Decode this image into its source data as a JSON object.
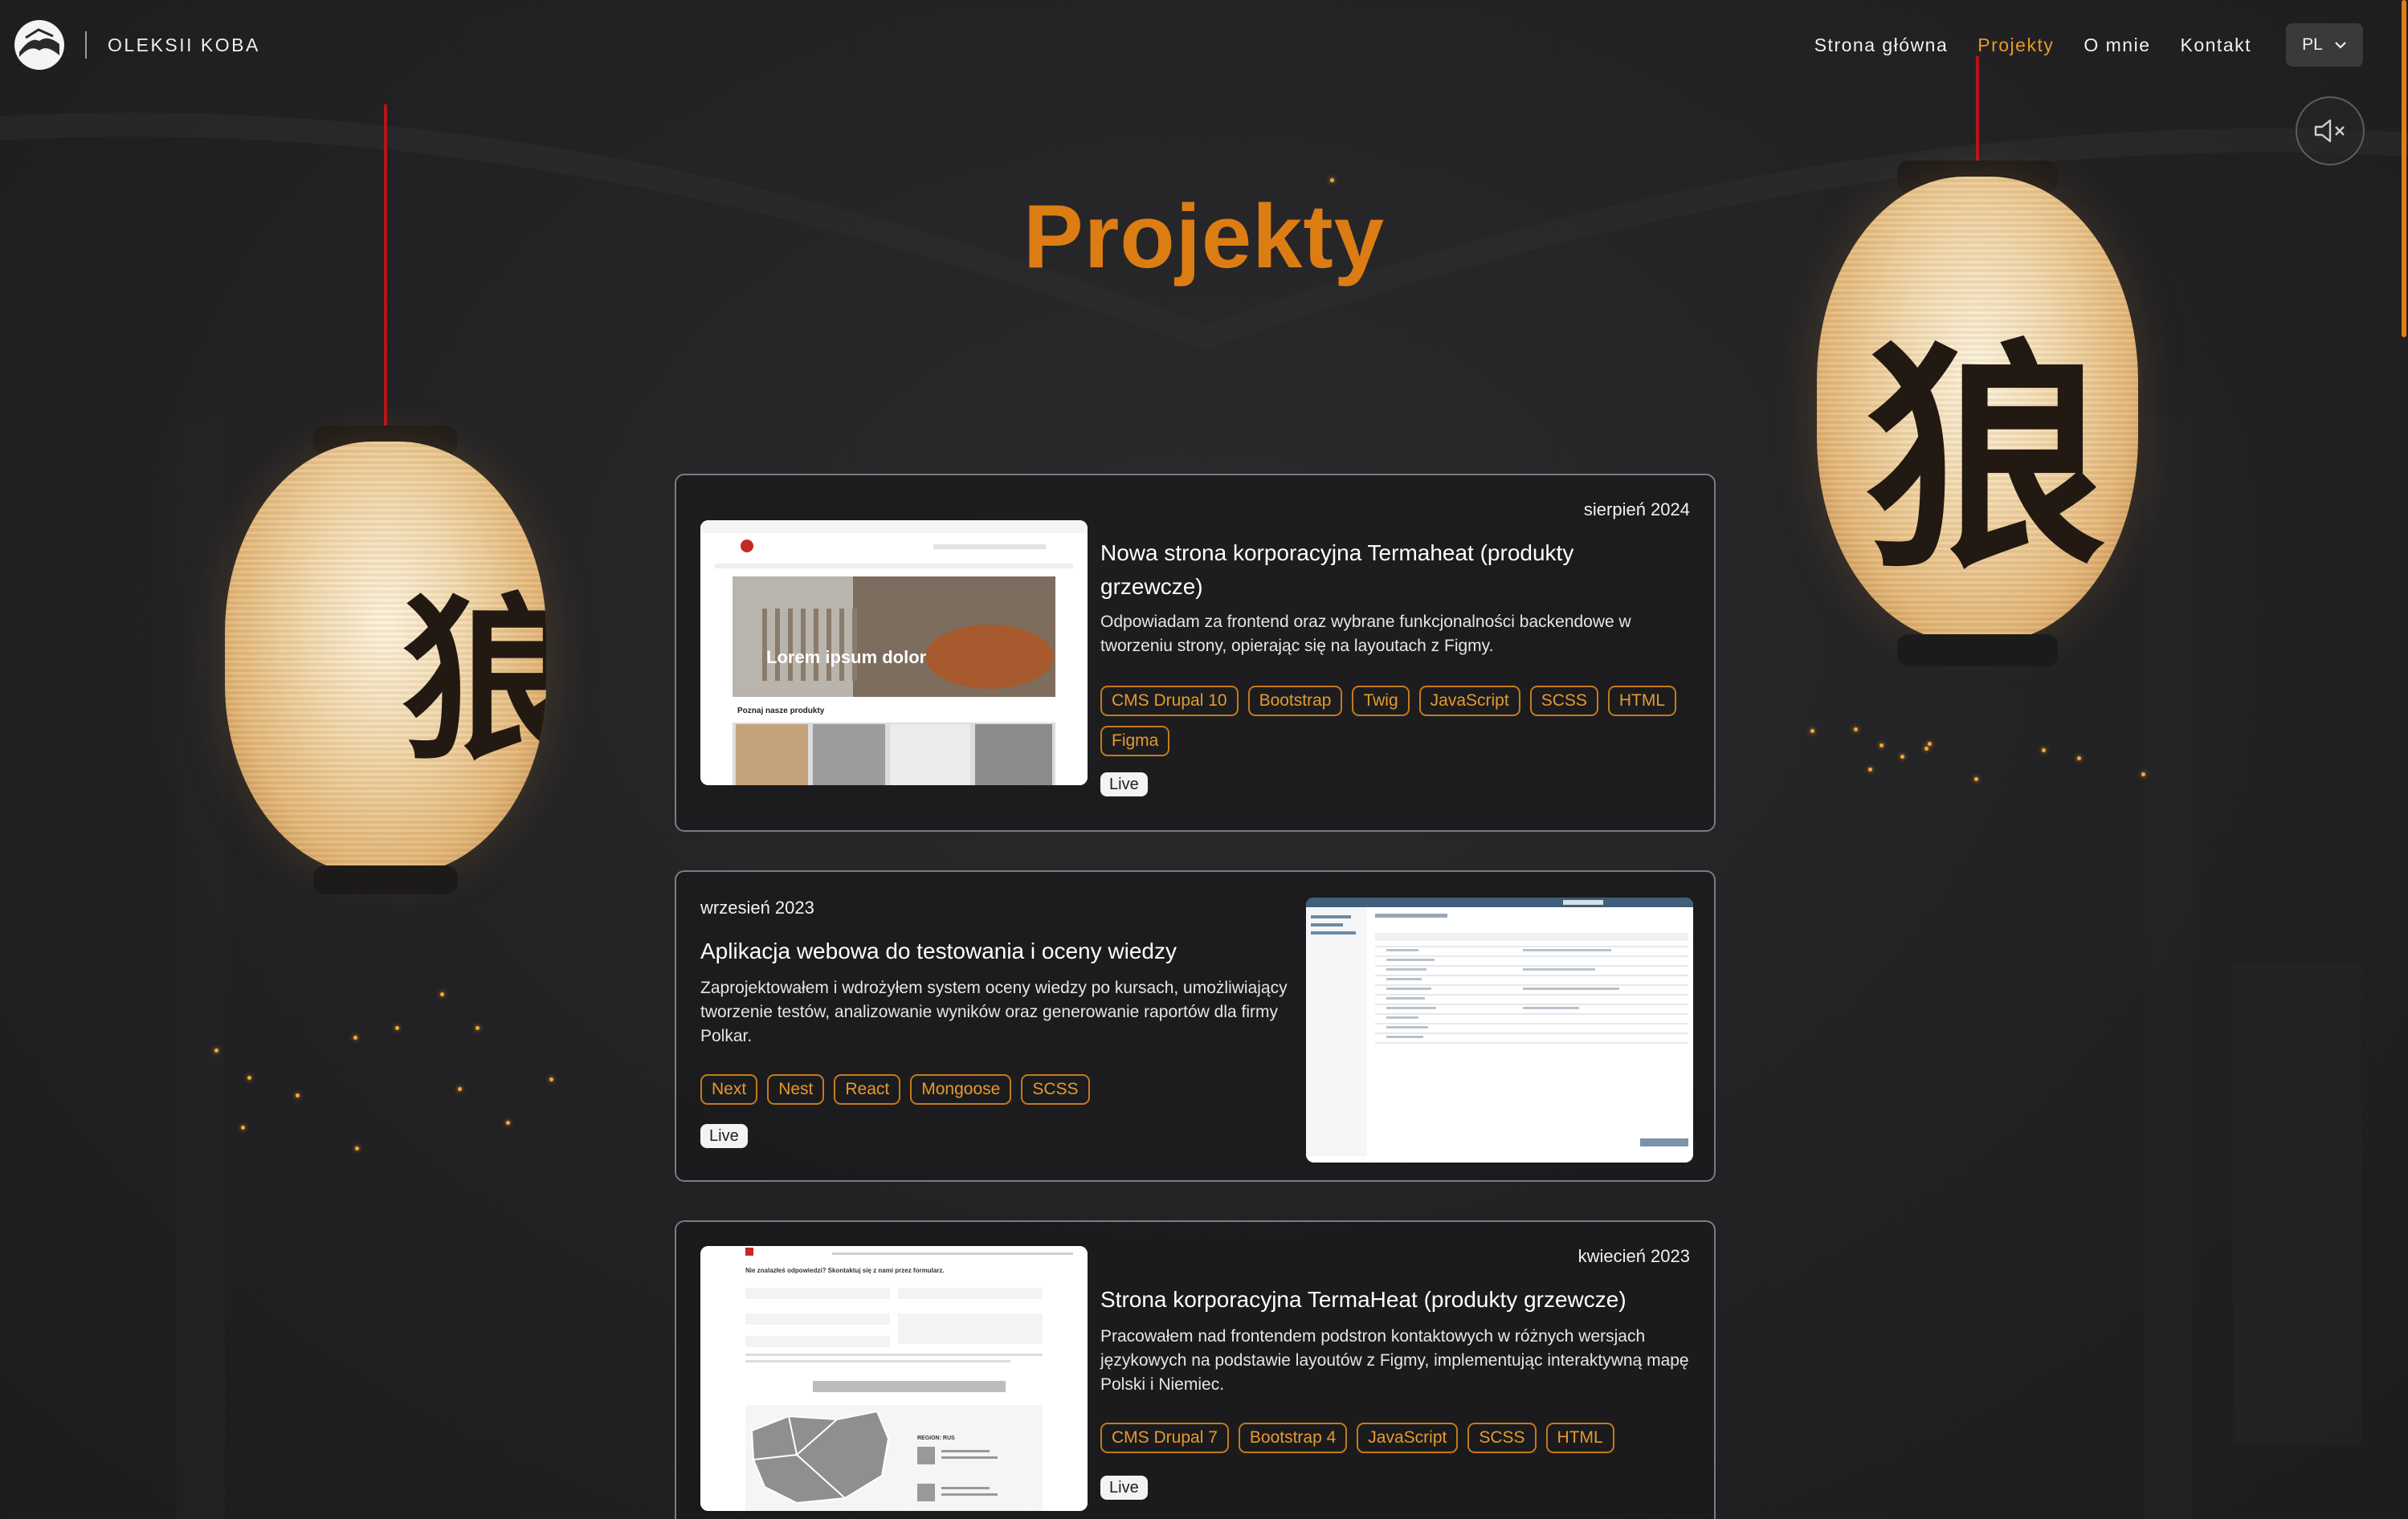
{
  "header": {
    "brand_name": "OLEKSII KOBA",
    "nav": [
      {
        "label": "Strona główna",
        "active": false
      },
      {
        "label": "Projekty",
        "active": true
      },
      {
        "label": "O mnie",
        "active": false
      },
      {
        "label": "Kontakt",
        "active": false
      }
    ],
    "language": "PL"
  },
  "page_title": "Projekty",
  "lantern_glyph": "狼",
  "colors": {
    "accent": "#dc7d14",
    "tag_border": "#c47a1a",
    "background": "#222224"
  },
  "thumb_texts": {
    "hero_heading": "Lorem ipsum dolor",
    "products_heading": "Poznaj nasze produkty",
    "contact_heading": "Nie znalazłeś odpowiedzi? Skontaktuj się z nami przez formularz.",
    "contact_region": "REGION: RUS"
  },
  "projects": [
    {
      "date": "sierpień 2024",
      "title": "Nowa strona korporacyjna Termaheat (produkty grzewcze)",
      "description": "Odpowiadam za frontend oraz wybrane funkcjonalności backendowe w tworzeniu strony, opierając się na layoutach z Figmy.",
      "tags": [
        "CMS Drupal 10",
        "Bootstrap",
        "Twig",
        "JavaScript",
        "SCSS",
        "HTML",
        "Figma"
      ],
      "link": "Live"
    },
    {
      "date": "wrzesień 2023",
      "title": "Aplikacja webowa do testowania i oceny wiedzy",
      "description": "Zaprojektowałem i wdrożyłem system oceny wiedzy po kursach, umożliwiający tworzenie testów, analizowanie wyników oraz generowanie raportów dla firmy Polkar.",
      "tags": [
        "Next",
        "Nest",
        "React",
        "Mongoose",
        "SCSS"
      ],
      "link": "Live"
    },
    {
      "date": "kwiecień 2023",
      "title": "Strona korporacyjna TermaHeat (produkty grzewcze)",
      "description": "Pracowałem nad frontendem podstron kontaktowych w różnych wersjach językowych na podstawie layoutów z Figmy, implementując interaktywną mapę Polski i Niemiec.",
      "tags": [
        "CMS Drupal 7",
        "Bootstrap 4",
        "JavaScript",
        "SCSS",
        "HTML"
      ],
      "link": "Live"
    }
  ]
}
